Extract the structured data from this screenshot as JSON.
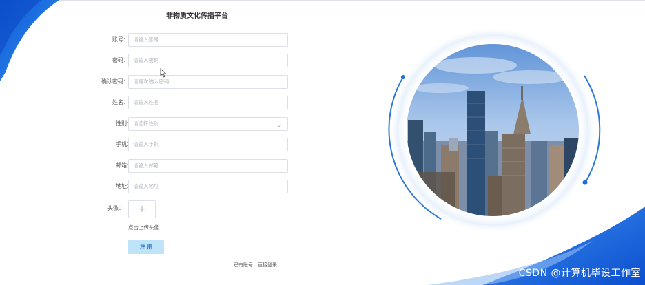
{
  "title": "非物质文化传播平台",
  "form": {
    "fields": [
      {
        "label": "账号：",
        "required": true,
        "placeholder": "请输入账号"
      },
      {
        "label": "密码：",
        "required": true,
        "placeholder": "请输入密码"
      },
      {
        "label": "确认密码：",
        "required": true,
        "placeholder": "请再次输入密码"
      },
      {
        "label": "姓名：",
        "required": true,
        "placeholder": "请输入姓名"
      },
      {
        "label": "性别：",
        "required": false,
        "placeholder": "请选择性别"
      },
      {
        "label": "手机：",
        "required": false,
        "placeholder": "请输入手机"
      },
      {
        "label": "邮箱：",
        "required": false,
        "placeholder": "请输入邮箱"
      },
      {
        "label": "地址：",
        "required": false,
        "placeholder": "请输入地址"
      }
    ],
    "required_mark": "*",
    "avatar_label": "头像：",
    "upload_plus": "+",
    "upload_hint": "点击上传头像",
    "register_label": "注 册",
    "login_link": "已有账号，直接登录",
    "select_arrow_icon": "chevron-down-icon"
  },
  "watermark": "CSDN @计算机毕设工作室",
  "colors": {
    "accent_blue": "#1e6fd9",
    "button_bg": "#bfe3f8",
    "required": "#f56c6c",
    "border": "#dcdfe6"
  }
}
